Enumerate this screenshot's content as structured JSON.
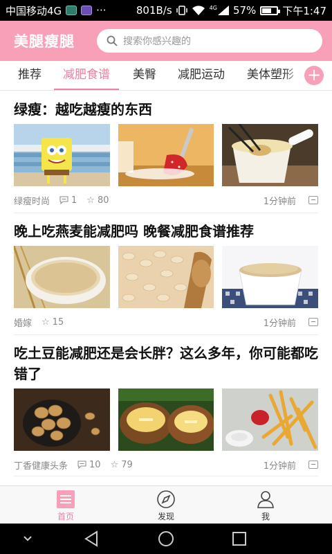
{
  "status_bar": {
    "carrier": "中国移动4G",
    "more": "···",
    "net_speed": "801B/s",
    "network_badge": "4G",
    "battery": "57%",
    "time": "下午1:47"
  },
  "header": {
    "app_title": "美腿瘦腿",
    "search_placeholder": "搜索你感兴趣的",
    "accent_color": "#f7a0b8"
  },
  "tabs": {
    "items": [
      {
        "label": "推荐"
      },
      {
        "label": "减肥食谱",
        "active": true
      },
      {
        "label": "美臀"
      },
      {
        "label": "减肥运动"
      },
      {
        "label": "美体塑形"
      }
    ],
    "add_label": "+"
  },
  "feed": {
    "articles": [
      {
        "title": "绿瘦：越吃越瘦的东西",
        "source": "绿瘦时尚",
        "comments": "1",
        "favorites": "80",
        "time": "1分钟前",
        "images": [
          "sponge-cartoon",
          "strawberry-fork",
          "soup-spoon"
        ]
      },
      {
        "title": "晚上吃燕麦能减肥吗 晚餐减肥食谱推荐",
        "source": "婚嫁",
        "comments": "",
        "favorites": "15",
        "time": "1分钟前",
        "images": [
          "oats-bowl",
          "oats-spoon",
          "oats-cup"
        ]
      },
      {
        "title": "吃土豆能减肥还是会长胖？这么多年，你可能都吃错了",
        "source": "丁香健康头条",
        "comments": "10",
        "favorites": "79",
        "time": "1分钟前",
        "images": [
          "potatoes",
          "baked-potatoes",
          "fries"
        ]
      }
    ]
  },
  "bottom_nav": {
    "items": [
      {
        "label": "首页",
        "active": true,
        "icon": "home-list-icon"
      },
      {
        "label": "发现",
        "icon": "compass-icon"
      },
      {
        "label": "我",
        "icon": "person-icon"
      }
    ]
  },
  "system_nav": {
    "icons": [
      "chevron-down-icon",
      "back-icon",
      "home-icon",
      "recents-icon"
    ]
  }
}
